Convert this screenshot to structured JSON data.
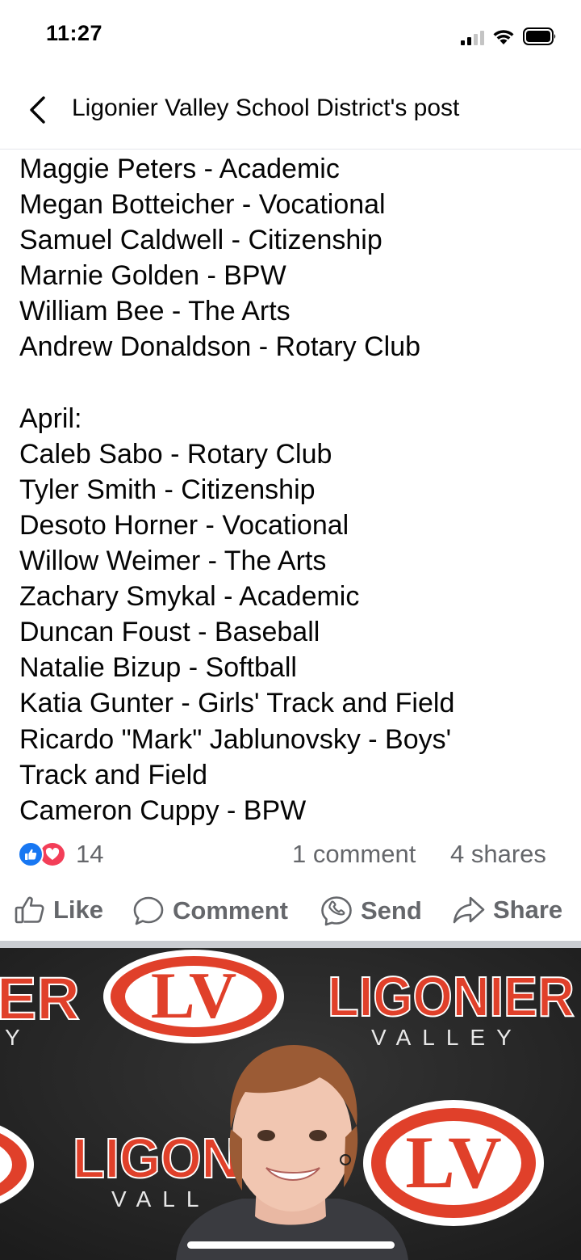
{
  "status_bar": {
    "time": "11:27"
  },
  "header": {
    "title": "Ligonier Valley School District's post"
  },
  "post": {
    "lines": [
      "Maggie Peters - Academic",
      "Megan Botteicher - Vocational",
      "Samuel Caldwell - Citizenship",
      "Marnie Golden - BPW",
      "William Bee - The Arts",
      "Andrew Donaldson - Rotary Club",
      "",
      "April:",
      "Caleb Sabo - Rotary Club",
      "Tyler Smith - Citizenship",
      "Desoto Horner - Vocational",
      "Willow Weimer - The Arts",
      "Zachary Smykal - Academic",
      "Duncan Foust - Baseball",
      "Natalie Bizup - Softball",
      "Katia Gunter - Girls' Track and Field",
      "Ricardo \"Mark\" Jablunovsky - Boys'",
      "Track and Field",
      "Cameron Cuppy - BPW"
    ]
  },
  "engagement": {
    "reaction_count": "14",
    "comments": "1 comment",
    "shares": "4 shares"
  },
  "actions": {
    "like": "Like",
    "comment": "Comment",
    "send": "Send",
    "share": "Share"
  },
  "photo": {
    "banner_text_1": "ER",
    "banner_text_2": "Y",
    "logo_text": "LV",
    "brand_1": "LIGONIER",
    "brand_1_sub": "VALLEY",
    "brand_2": "LIGONI",
    "brand_2_sub": "VALL",
    "colors": {
      "background": "#232323",
      "accent": "#e0402a",
      "logo_ring": "#ffffff"
    }
  },
  "colors": {
    "like_blue": "#1877f2",
    "love_red": "#f33e58",
    "meta_gray": "#65676b"
  }
}
